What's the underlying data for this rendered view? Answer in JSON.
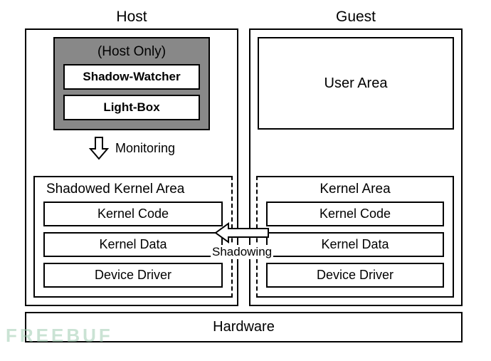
{
  "host": {
    "title": "Host",
    "hostOnly": {
      "title": "(Host Only)",
      "shadowWatcher": "Shadow-Watcher",
      "lightBox": "Light-Box"
    },
    "monitoringLabel": "Monitoring",
    "kernelArea": {
      "title": "Shadowed Kernel Area",
      "code": "Kernel Code",
      "data": "Kernel Data",
      "driver": "Device Driver"
    }
  },
  "guest": {
    "title": "Guest",
    "userArea": "User Area",
    "kernelArea": {
      "title": "Kernel Area",
      "code": "Kernel Code",
      "data": "Kernel Data",
      "driver": "Device Driver"
    }
  },
  "shadowingLabel": "Shadowing",
  "hardware": "Hardware",
  "watermark": "FREEBUF"
}
